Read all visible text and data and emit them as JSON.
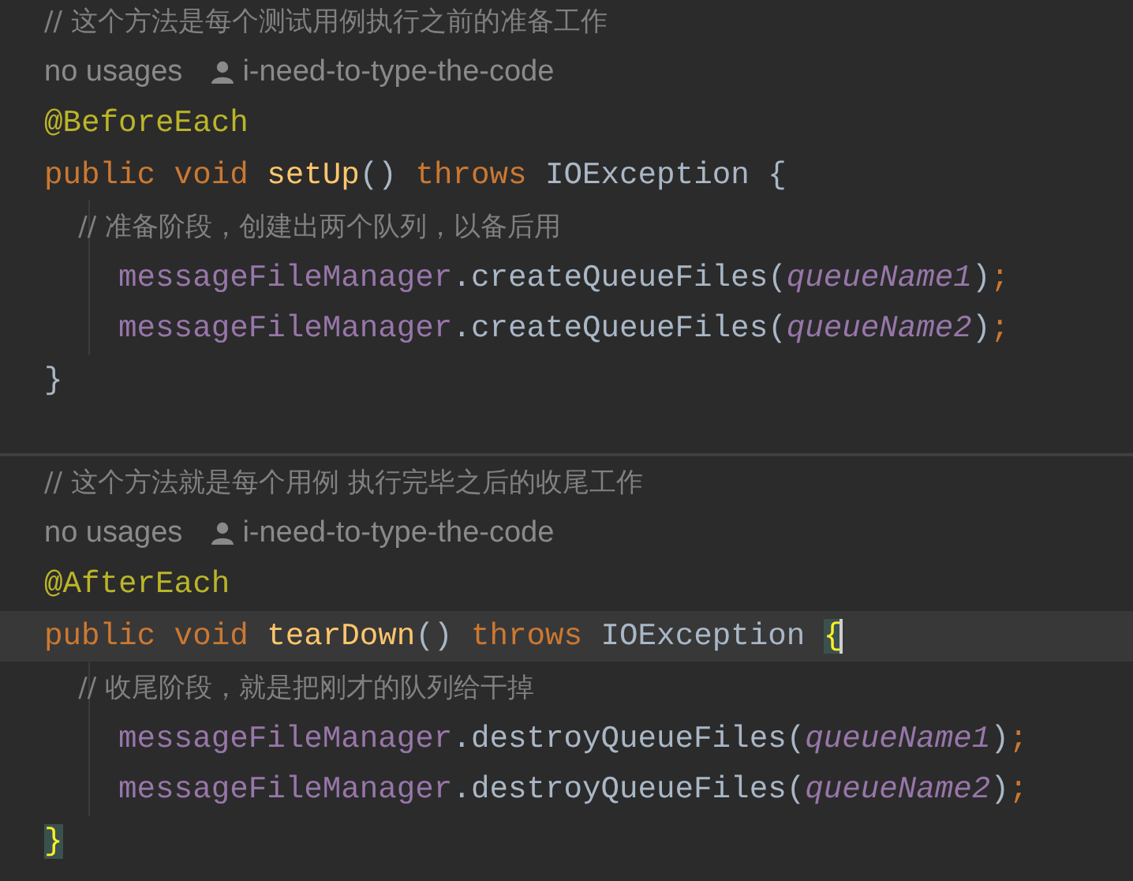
{
  "methods": [
    {
      "lines": [
        {
          "kind": "comment",
          "text": "// 这个方法是每个测试用例执行之前的准备工作"
        },
        {
          "kind": "hint",
          "usages": "no usages",
          "author": "i-need-to-type-the-code"
        },
        {
          "kind": "code",
          "current": false,
          "tokens": [
            {
              "kind": "annotation",
              "text": "@BeforeEach"
            }
          ]
        },
        {
          "kind": "code",
          "current": false,
          "tokens": [
            {
              "kind": "keyword",
              "text": "public void "
            },
            {
              "kind": "declaration",
              "text": "setUp"
            },
            {
              "kind": "plain",
              "text": "() "
            },
            {
              "kind": "keyword",
              "text": "throws "
            },
            {
              "kind": "plain",
              "text": "IOException "
            },
            {
              "kind": "plain",
              "text": "{",
              "matched": false
            }
          ]
        },
        {
          "kind": "comment",
          "text": "    // 准备阶段，创建出两个队列，以备后用"
        },
        {
          "kind": "code",
          "current": false,
          "tokens": [
            {
              "kind": "field",
              "text": "    messageFileManager"
            },
            {
              "kind": "plain",
              "text": ".createQueueFiles("
            },
            {
              "kind": "param",
              "text": "queueName1"
            },
            {
              "kind": "plain",
              "text": ")"
            },
            {
              "kind": "semicolon",
              "text": ";"
            }
          ]
        },
        {
          "kind": "code",
          "current": false,
          "tokens": [
            {
              "kind": "field",
              "text": "    messageFileManager"
            },
            {
              "kind": "plain",
              "text": ".createQueueFiles("
            },
            {
              "kind": "param",
              "text": "queueName2"
            },
            {
              "kind": "plain",
              "text": ")"
            },
            {
              "kind": "semicolon",
              "text": ";"
            }
          ]
        },
        {
          "kind": "code",
          "current": false,
          "tokens": [
            {
              "kind": "plain",
              "text": "}",
              "matched": false
            }
          ]
        }
      ]
    },
    {
      "lines": [
        {
          "kind": "comment",
          "text": "// 这个方法就是每个用例 执行完毕之后的收尾工作"
        },
        {
          "kind": "hint",
          "usages": "no usages",
          "author": "i-need-to-type-the-code"
        },
        {
          "kind": "code",
          "current": false,
          "tokens": [
            {
              "kind": "annotation",
              "text": "@AfterEach"
            }
          ]
        },
        {
          "kind": "code",
          "current": true,
          "tokens": [
            {
              "kind": "keyword",
              "text": "public void "
            },
            {
              "kind": "declaration",
              "text": "tearDown"
            },
            {
              "kind": "plain",
              "text": "() "
            },
            {
              "kind": "keyword",
              "text": "throws "
            },
            {
              "kind": "plain",
              "text": "IOException "
            },
            {
              "kind": "plain",
              "text": "{",
              "matched": true
            }
          ]
        },
        {
          "kind": "comment",
          "text": "    // 收尾阶段，就是把刚才的队列给干掉"
        },
        {
          "kind": "code",
          "current": false,
          "tokens": [
            {
              "kind": "field",
              "text": "    messageFileManager"
            },
            {
              "kind": "plain",
              "text": ".destroyQueueFiles("
            },
            {
              "kind": "param",
              "text": "queueName1"
            },
            {
              "kind": "plain",
              "text": ")"
            },
            {
              "kind": "semicolon",
              "text": ";"
            }
          ]
        },
        {
          "kind": "code",
          "current": false,
          "tokens": [
            {
              "kind": "field",
              "text": "    messageFileManager"
            },
            {
              "kind": "plain",
              "text": ".destroyQueueFiles("
            },
            {
              "kind": "param",
              "text": "queueName2"
            },
            {
              "kind": "plain",
              "text": ")"
            },
            {
              "kind": "semicolon",
              "text": ";"
            }
          ]
        },
        {
          "kind": "code",
          "current": false,
          "tokens": [
            {
              "kind": "plain",
              "text": "}",
              "matched": true
            }
          ]
        }
      ]
    }
  ]
}
